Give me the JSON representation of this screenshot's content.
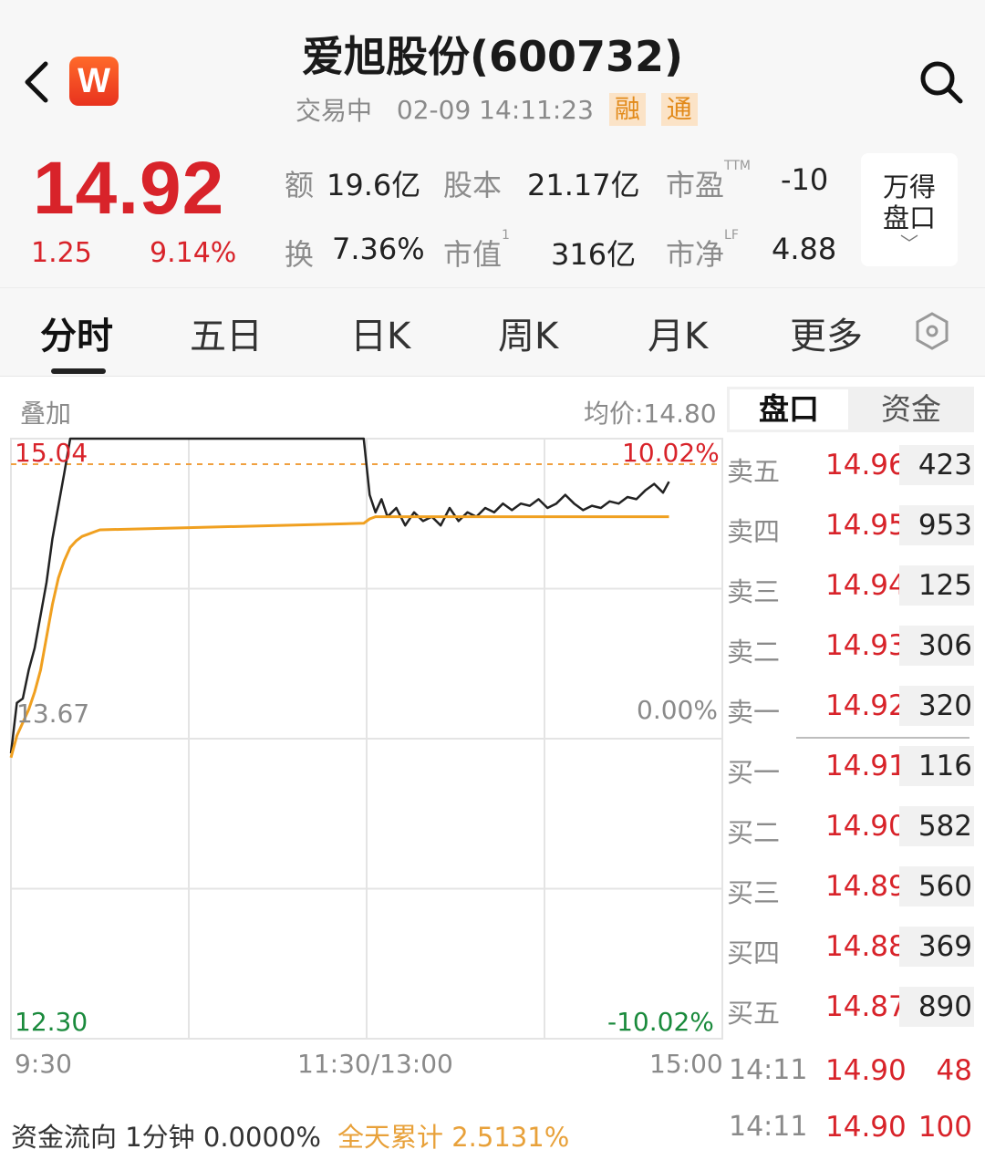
{
  "header": {
    "title": "爱旭股份(600732)",
    "status": "交易中",
    "datetime": "02-09 14:11:23",
    "tags": [
      "融",
      "通"
    ]
  },
  "quote": {
    "price": "14.92",
    "change": "1.25",
    "change_pct": "9.14%",
    "stats": [
      {
        "label": "额",
        "value": "19.6亿"
      },
      {
        "label": "股本",
        "value": "21.17亿"
      },
      {
        "label": "市盈",
        "sup": "TTM",
        "value": "-10"
      },
      {
        "label": "换",
        "value": "7.36%"
      },
      {
        "label": "市值",
        "sup": "1",
        "value": "316亿"
      },
      {
        "label": "市净",
        "sup": "LF",
        "value": "4.88"
      }
    ],
    "wind_button": {
      "line1": "万得",
      "line2": "盘口"
    }
  },
  "tabs": [
    "分时",
    "五日",
    "日K",
    "周K",
    "月K",
    "更多"
  ],
  "chart": {
    "overlay_label": "叠加",
    "avg_price_label": "均价:14.80",
    "price_top": "15.04",
    "pct_top": "10.02%",
    "price_mid": "13.67",
    "pct_mid": "0.00%",
    "price_bottom": "12.30",
    "pct_bottom": "-10.02%",
    "time_labels": [
      "9:30",
      "11:30/13:00",
      "15:00"
    ]
  },
  "chart_data": {
    "type": "line",
    "title": "",
    "xlabel": "",
    "ylabel": "",
    "ylim": [
      12.3,
      15.04
    ],
    "prev_close": 13.67,
    "x_ticks": [
      "9:30",
      "11:30/13:00",
      "15:00"
    ],
    "x": [
      0,
      2,
      4,
      6,
      8,
      10,
      12,
      14,
      16,
      18,
      20,
      22,
      24,
      26,
      28,
      30,
      60,
      90,
      119,
      121,
      123,
      125,
      127,
      130,
      133,
      136,
      139,
      142,
      145,
      148,
      151,
      154,
      157,
      160,
      163,
      166,
      169,
      172,
      175,
      178,
      181,
      184,
      187,
      190,
      193,
      196,
      199,
      202,
      205,
      208,
      211,
      214,
      217,
      220,
      222
    ],
    "series": [
      {
        "values": [
          13.72,
          13.95,
          13.97,
          14.1,
          14.2,
          14.35,
          14.5,
          14.7,
          14.85,
          15.0,
          15.04,
          15.04,
          15.04,
          15.04,
          15.04,
          15.04,
          15.04,
          15.04,
          15.04,
          14.9,
          14.82,
          14.88,
          14.8,
          14.84,
          14.76,
          14.82,
          14.78,
          14.8,
          14.76,
          14.84,
          14.78,
          14.82,
          14.8,
          14.84,
          14.82,
          14.86,
          14.83,
          14.86,
          14.85,
          14.88,
          14.84,
          14.86,
          14.9,
          14.86,
          14.83,
          14.85,
          14.84,
          14.87,
          14.86,
          14.89,
          14.88,
          14.92,
          14.95,
          14.91,
          14.96
        ]
      },
      {
        "values": [
          13.7,
          13.8,
          13.86,
          13.92,
          14.0,
          14.1,
          14.25,
          14.4,
          14.52,
          14.6,
          14.66,
          14.69,
          14.71,
          14.72,
          14.73,
          14.74,
          14.75,
          14.76,
          14.77,
          14.79,
          14.8,
          14.8,
          14.8,
          14.8,
          14.8,
          14.8,
          14.8,
          14.8,
          14.8,
          14.8,
          14.8,
          14.8,
          14.8,
          14.8,
          14.8,
          14.8,
          14.8,
          14.8,
          14.8,
          14.8,
          14.8,
          14.8,
          14.8,
          14.8,
          14.8,
          14.8,
          14.8,
          14.8,
          14.8,
          14.8,
          14.8,
          14.8,
          14.8,
          14.8,
          14.8
        ]
      }
    ],
    "x_total_minutes": 240,
    "grid": true
  },
  "sidebar": {
    "tabs": [
      "盘口",
      "资金"
    ],
    "asks": [
      {
        "label": "卖五",
        "price": "14.96",
        "vol": "423"
      },
      {
        "label": "卖四",
        "price": "14.95",
        "vol": "953"
      },
      {
        "label": "卖三",
        "price": "14.94",
        "vol": "125"
      },
      {
        "label": "卖二",
        "price": "14.93",
        "vol": "306"
      },
      {
        "label": "卖一",
        "price": "14.92",
        "vol": "320"
      }
    ],
    "bids": [
      {
        "label": "买一",
        "price": "14.91",
        "vol": "116"
      },
      {
        "label": "买二",
        "price": "14.90",
        "vol": "582"
      },
      {
        "label": "买三",
        "price": "14.89",
        "vol": "560"
      },
      {
        "label": "买四",
        "price": "14.88",
        "vol": "369"
      },
      {
        "label": "买五",
        "price": "14.87",
        "vol": "890"
      }
    ],
    "ticks": [
      {
        "time": "14:11",
        "price": "14.90",
        "vol": "48"
      },
      {
        "time": "14:11",
        "price": "14.90",
        "vol": "100"
      }
    ]
  },
  "footer": {
    "flow": "资金流向 1分钟 0.0000%",
    "total": "全天累计 2.5131%"
  },
  "colors": {
    "up": "#d8232a",
    "down": "#1a8a3c",
    "avg_line": "#f0a020",
    "price_line": "#222222"
  }
}
